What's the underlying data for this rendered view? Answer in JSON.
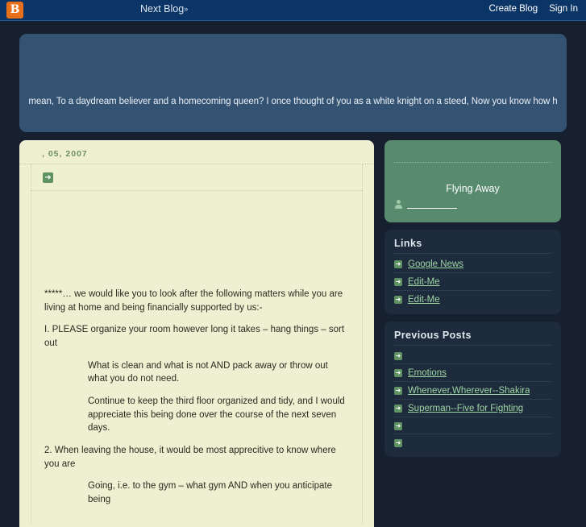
{
  "navbar": {
    "logo_icon": "blogger-b-icon",
    "logo_letter": "B",
    "next_blog_label": "Next Blog",
    "next_blog_chevron": "»",
    "create_blog_label": "Create Blog",
    "sign_in_label": "Sign In",
    "background_color": "#0b3566",
    "logo_color": "#e8701a"
  },
  "header": {
    "title": "",
    "description": "mean, To a daydream believer and a homecoming queen? I once thought of you as a white knight on a steed, Now you know how h",
    "background_color": "#345373"
  },
  "post": {
    "date": ",    05, 2007",
    "title": "",
    "arrow_icon": "arrow-right-icon",
    "paragraphs": [
      {
        "text": "*****… we would like you to look after the following matters while you are living at home and being financially supported by us:-",
        "indent": false
      },
      {
        "text": "I. PLEASE organize your room however long it takes – hang things – sort out",
        "indent": false
      },
      {
        "text": "What is clean and what is not AND pack away or throw out what you do not need.",
        "indent": true
      },
      {
        "text": "Continue to keep the third floor organized and tidy, and I would appreciate this being done over the course of the next seven days.",
        "indent": true
      },
      {
        "text": "2. When leaving the house, it would be most apprecitive to know where you are",
        "indent": false
      },
      {
        "text": "Going, i.e. to the gym – what gym AND when you anticipate being",
        "indent": true
      }
    ],
    "background_color": "#eff0d2"
  },
  "sidebar": {
    "profile": {
      "name": "Flying Away",
      "person_icon": "person-icon",
      "profile_link_label": "",
      "background_color": "#588a6e"
    },
    "links_panel": {
      "title": "Links",
      "items": [
        {
          "label": "Google News",
          "blank": false
        },
        {
          "label": "Edit-Me",
          "blank": false
        },
        {
          "label": "Edit-Me",
          "blank": false
        }
      ]
    },
    "previous_posts_panel": {
      "title": "Previous Posts",
      "items": [
        {
          "label": "",
          "blank": true,
          "small": false
        },
        {
          "label": "Emotions",
          "blank": false,
          "small": false
        },
        {
          "label": "Whenever,Wherever--Shakira",
          "blank": false,
          "small": false
        },
        {
          "label": "Superman--Five for Fighting",
          "blank": false,
          "small": false
        },
        {
          "label": "",
          "blank": true,
          "small": true
        },
        {
          "label": "",
          "blank": true,
          "small": true
        }
      ]
    },
    "panel_background_color": "#1e2b3c",
    "link_color": "#9ed6a4"
  }
}
